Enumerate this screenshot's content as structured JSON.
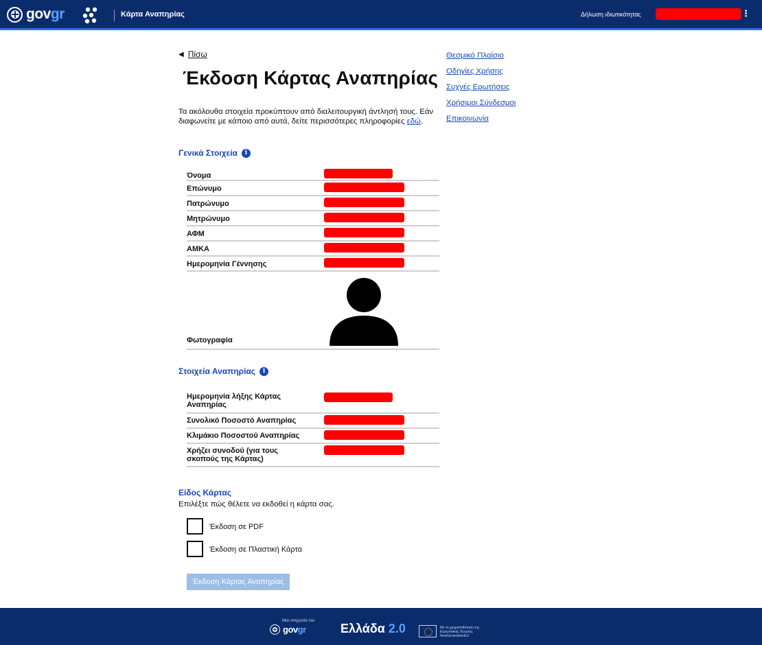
{
  "header": {
    "logo_text_main": "gov",
    "logo_text_accent": "gr",
    "service_title": "Κάρτα Αναπηρίας",
    "privacy_link": "Δήλωση ιδιωτικότητας",
    "menu_glyph": "⋮",
    "user_name_redacted": true
  },
  "nav": {
    "back_arrow": "◀",
    "back_label": "Πίσω"
  },
  "page": {
    "title": "Έκδοση Κάρτας Αναπηρίας",
    "intro_text": "Τα ακόλουθα στοιχεία προκύπτουν από διαλειτουργική άντλησή τους. Εάν διαφωνείτε με κάποιο από αυτά, δείτε περισσότερες πληροφορίες ",
    "intro_link": "εδώ",
    "intro_end": "."
  },
  "general": {
    "title": "Γενικά Στοιχεία",
    "info_icon": "i",
    "fields": [
      {
        "label": "Όνομα",
        "value_redacted": true
      },
      {
        "label": "Επώνυμο",
        "value_redacted": true
      },
      {
        "label": "Πατρώνυμο",
        "value_redacted": true
      },
      {
        "label": "Μητρώνυμο",
        "value_redacted": true
      },
      {
        "label": "ΑΦΜ",
        "value_redacted": true
      },
      {
        "label": "ΑΜΚΑ",
        "value_redacted": true
      },
      {
        "label": "Ημερομηνία Γέννησης",
        "value_redacted": true
      }
    ],
    "photo_label": "Φωτογραφία",
    "photo_icon": "person-silhouette-icon"
  },
  "disability": {
    "title": "Στοιχεία Αναπηρίας",
    "info_icon": "i",
    "fields": [
      {
        "label": "Ημερομηνία λήξης Κάρτας Αναπηρίας",
        "value_redacted": true
      },
      {
        "label": "Συνολικό Ποσοστό Αναπηρίας",
        "value_redacted": true
      },
      {
        "label": "Κλιμάκιο Ποσοστού Αναπηρίας",
        "value_redacted": true
      },
      {
        "label": "Χρήζει συνοδού (για τους σκοπούς της Κάρτας)",
        "value_redacted": true
      }
    ]
  },
  "card_type": {
    "title": "Είδος Κάρτας",
    "subtitle": "Επιλέξτε πώς θέλετε να εκδοθεί η κάρτα σας.",
    "options": [
      {
        "label": "Έκδοση σε PDF",
        "checked": false
      },
      {
        "label": "Έκδοση σε Πλαστική Κάρτα",
        "checked": false
      }
    ],
    "submit_label": "Έκδοση Κάρτας Αναπηρίας"
  },
  "sidebar": {
    "links": [
      "Θεσμικό Πλαίσιο",
      "Οδηγίες Χρήσης",
      "Συχνές Ερωτήσεις",
      "Χρήσιμοι Σύνδεσμοι",
      "Επικοινωνία"
    ]
  },
  "footer": {
    "service_of": "Μια υπηρεσία του",
    "logo_text_main": "gov",
    "logo_text_accent": "gr",
    "ellada_text": "Ελλάδα",
    "ellada_version": "2.0",
    "eu_text": "Με τη χρηματοδότηση της Ευρωπαϊκής Ένωσης NextGenerationEU"
  },
  "colors": {
    "header_bg": "#0b2c6b",
    "link_blue": "#1a47b8",
    "redaction": "#ff0000",
    "button_disabled": "#9cbde6"
  }
}
